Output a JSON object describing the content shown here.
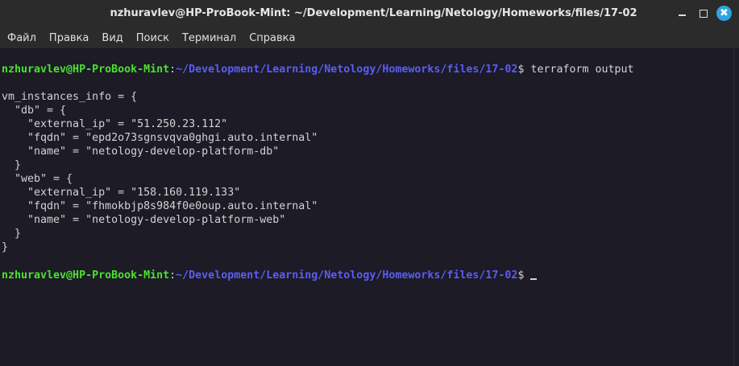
{
  "window": {
    "title": "nzhuravlev@HP-ProBook-Mint: ~/Development/Learning/Netology/Homeworks/files/17-02",
    "buttons": [
      "minimize-icon",
      "maximize-icon",
      "close-icon"
    ],
    "close_glyph": "✖"
  },
  "menu": {
    "items": [
      "Файл",
      "Правка",
      "Вид",
      "Поиск",
      "Терминал",
      "Справка"
    ]
  },
  "prompt": {
    "user_host": "nzhuravlev@HP-ProBook-Mint",
    "colon": ":",
    "path": "~/Development/Learning/Netology/Homeworks/files/17-02",
    "dollar": "$ "
  },
  "command": "terraform output",
  "output": [
    "vm_instances_info = {",
    "  \"db\" = {",
    "    \"external_ip\" = \"51.250.23.112\"",
    "    \"fqdn\" = \"epd2o73sgnsvqva0ghgi.auto.internal\"",
    "    \"name\" = \"netology-develop-platform-db\"",
    "  }",
    "  \"web\" = {",
    "    \"external_ip\" = \"158.160.119.133\"",
    "    \"fqdn\" = \"fhmokbjp8s984f0e0oup.auto.internal\"",
    "    \"name\" = \"netology-develop-platform-web\"",
    "  }",
    "}"
  ],
  "colors": {
    "user": "#4be22d",
    "path": "#5c5cf5",
    "text": "#d3d3d3",
    "background": "#1c1b26",
    "close": "#2ea3e3"
  }
}
